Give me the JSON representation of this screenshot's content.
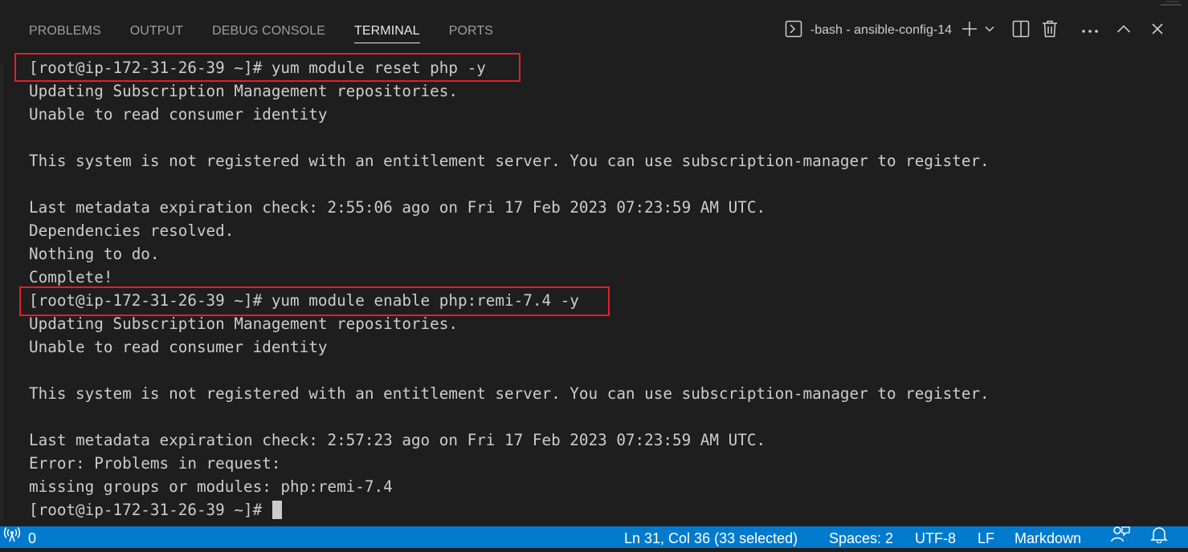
{
  "panel": {
    "tabs": [
      {
        "label": "PROBLEMS"
      },
      {
        "label": "OUTPUT"
      },
      {
        "label": "DEBUG CONSOLE"
      },
      {
        "label": "TERMINAL"
      },
      {
        "label": "PORTS"
      }
    ],
    "active_tab": "TERMINAL",
    "terminal_name": "-bash - ansible-config-14",
    "icons": {
      "terminal": "terminal-icon",
      "new_terminal": "plus-icon",
      "dropdown": "chevron-down-icon",
      "split": "split-editor-icon",
      "kill": "trash-icon",
      "more": "ellipsis-icon",
      "maximize": "chevron-up-icon",
      "close": "close-icon"
    }
  },
  "terminal": {
    "prompt": "[root@ip-172-31-26-39 ~]#",
    "lines": [
      "[root@ip-172-31-26-39 ~]# yum module reset php -y",
      "Updating Subscription Management repositories.",
      "Unable to read consumer identity",
      "",
      "This system is not registered with an entitlement server. You can use subscription-manager to register.",
      "",
      "Last metadata expiration check: 2:55:06 ago on Fri 17 Feb 2023 07:23:59 AM UTC.",
      "Dependencies resolved.",
      "Nothing to do.",
      "Complete!",
      "[root@ip-172-31-26-39 ~]# yum module enable php:remi-7.4 -y",
      "Updating Subscription Management repositories.",
      "Unable to read consumer identity",
      "",
      "This system is not registered with an entitlement server. You can use subscription-manager to register.",
      "",
      "Last metadata expiration check: 2:57:23 ago on Fri 17 Feb 2023 07:23:59 AM UTC.",
      "Error: Problems in request:",
      "missing groups or modules: php:remi-7.4",
      "[root@ip-172-31-26-39 ~]# "
    ],
    "highlight_color": "#e51e27"
  },
  "status_bar": {
    "ports_count": "0",
    "cursor_position": "Ln 31, Col 36 (33 selected)",
    "indentation": "Spaces: 2",
    "encoding": "UTF-8",
    "eol": "LF",
    "language": "Markdown",
    "icons": {
      "ports": "broadcast-icon",
      "feedback": "feedback-icon",
      "notifications": "bell-icon"
    },
    "color": "#007acc"
  },
  "colors": {
    "background": "#1e1e1e",
    "text": "#cccccc",
    "accent": "#007acc"
  }
}
